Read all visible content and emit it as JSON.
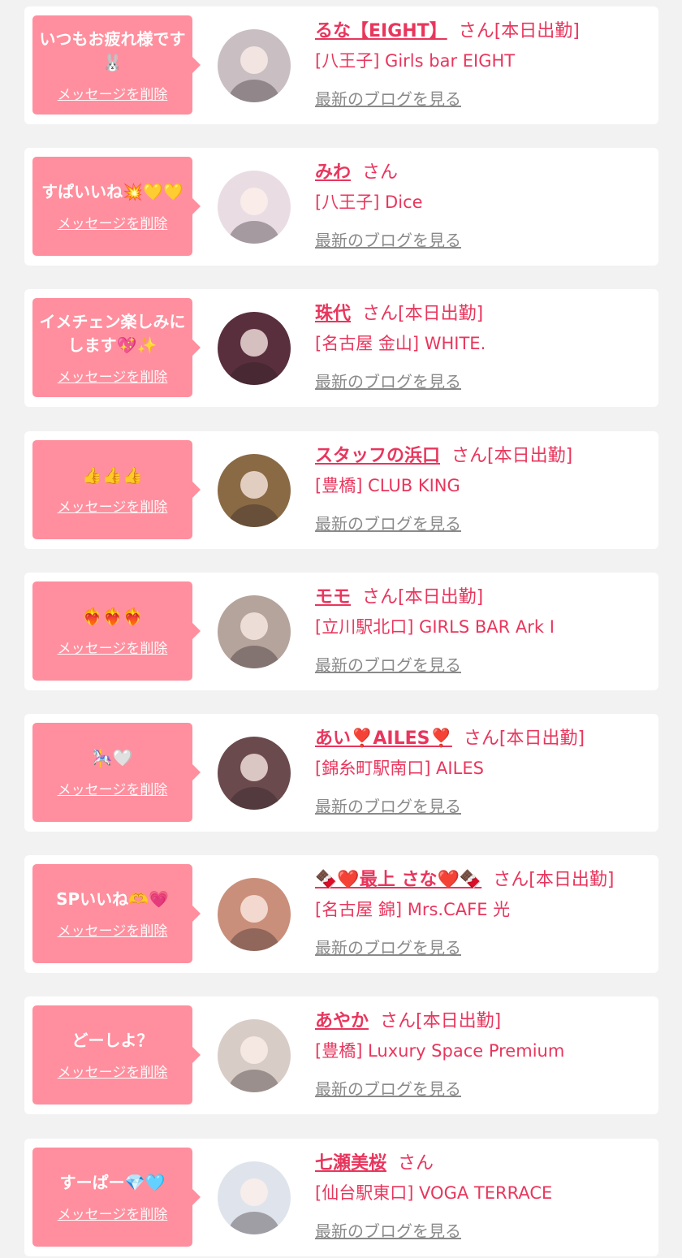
{
  "items": [
    {
      "message": "いつもお疲れ様です🐰",
      "delete_label": "メッセージを削除",
      "name": "るな【EIGHT】",
      "san": "さん",
      "status": "[本日出勤]",
      "shop": "[八王子] Girls bar EIGHT",
      "blog_label": "最新のブログを見る",
      "avatar_color": "#c9bfc2"
    },
    {
      "message": "すぱいいね💥💛💛",
      "delete_label": "メッセージを削除",
      "name": "みわ",
      "san": "さん",
      "status": "",
      "shop": "[八王子] Dice",
      "blog_label": "最新のブログを見る",
      "avatar_color": "#e9dde3"
    },
    {
      "message": "イメチェン楽しみにします💖✨",
      "delete_label": "メッセージを削除",
      "name": "珠代",
      "san": "さん",
      "status": "[本日出勤]",
      "shop": "[名古屋 金山] WHITE.",
      "blog_label": "最新のブログを見る",
      "avatar_color": "#5a2f3d"
    },
    {
      "message": "👍👍👍",
      "delete_label": "メッセージを削除",
      "name": "スタッフの浜口",
      "san": "さん",
      "status": "[本日出勤]",
      "shop": "[豊橋] CLUB KING",
      "blog_label": "最新のブログを見る",
      "avatar_color": "#8a6a45"
    },
    {
      "message": "❤️‍🔥❤️‍🔥❤️‍🔥",
      "delete_label": "メッセージを削除",
      "name": "モモ",
      "san": "さん",
      "status": "[本日出勤]",
      "shop": "[立川駅北口] GIRLS BAR Ark I",
      "blog_label": "最新のブログを見る",
      "avatar_color": "#b5a49c"
    },
    {
      "message": "🎠🤍",
      "delete_label": "メッセージを削除",
      "name": "あい❣️AILES❣️",
      "san": "さん",
      "status": "[本日出勤]",
      "shop": "[錦糸町駅南口] AILES",
      "blog_label": "最新のブログを見る",
      "avatar_color": "#6b4a4e"
    },
    {
      "message": "SPいいね🫶💗",
      "delete_label": "メッセージを削除",
      "name": "🍫❤️最上 さな❤️🍫",
      "san": "さん",
      "status": "[本日出勤]",
      "shop": "[名古屋 錦] Mrs.CAFE 光",
      "blog_label": "最新のブログを見る",
      "avatar_color": "#c98f7a"
    },
    {
      "message": "どーしよ？",
      "delete_label": "メッセージを削除",
      "name": "あやか",
      "san": "さん",
      "status": "[本日出勤]",
      "shop": "[豊橋] Luxury Space Premium",
      "blog_label": "最新のブログを見る",
      "avatar_color": "#d8ccc6"
    },
    {
      "message": "すーぱー💎🩵",
      "delete_label": "メッセージを削除",
      "name": "七瀬美桜",
      "san": "さん",
      "status": "",
      "shop": "[仙台駅東口] VOGA TERRACE",
      "blog_label": "最新のブログを見る",
      "avatar_color": "#dfe4ec"
    }
  ]
}
